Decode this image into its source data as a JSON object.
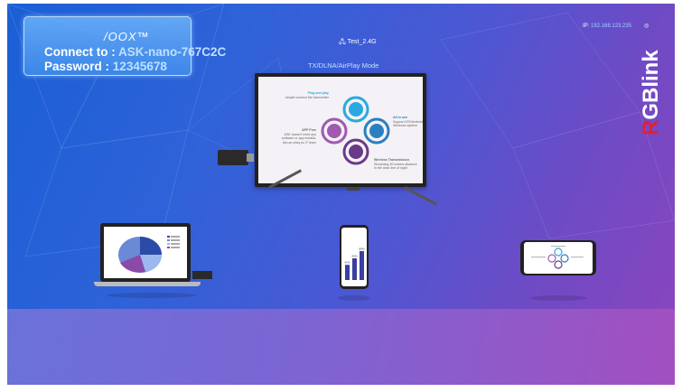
{
  "connect": {
    "logo": "/OOX™",
    "connect_label": "Connect to :",
    "ssid": "ASK-nano-767C2C",
    "password_label": "Password :",
    "password": "12345678"
  },
  "status": {
    "wifi_name": "Test_2.4G",
    "mode": "TX/DLNA/AirPlay Mode",
    "ip_label": "IP:",
    "ip_value": "192.168.123.235"
  },
  "brand": {
    "name": "RGBlink",
    "colors": {
      "R": "#e0203a",
      "G": "#ffffff",
      "B": "#ffffff",
      "rest": "#ffffff"
    }
  },
  "tv_features": {
    "plug_title": "Plug and play",
    "plug_desc": "simple connect the transmitter",
    "app_title": "APP Free",
    "app_desc_1": "ASK doesn't need any",
    "app_desc_2": "software or app installa-",
    "app_desc_3": "tion,an easy,no IT team",
    "all_title": "All in one",
    "all_desc_1": "Support iOS/Android",
    "all_desc_2": "Windows system",
    "wireless_title": "Wireless Transmission",
    "wireless_desc_1": "Streaming 30 meters distance",
    "wireless_desc_2": "in the clear line of sight"
  },
  "phone_bars": [
    {
      "label": "42%",
      "value": 42
    },
    {
      "label": "60%",
      "value": 60
    },
    {
      "label": "80%",
      "value": 80
    }
  ],
  "colors": {
    "accent_blue": "#2aa9e0",
    "accent_purple": "#7a3f9a",
    "bar_color": "#3a3fa0"
  }
}
